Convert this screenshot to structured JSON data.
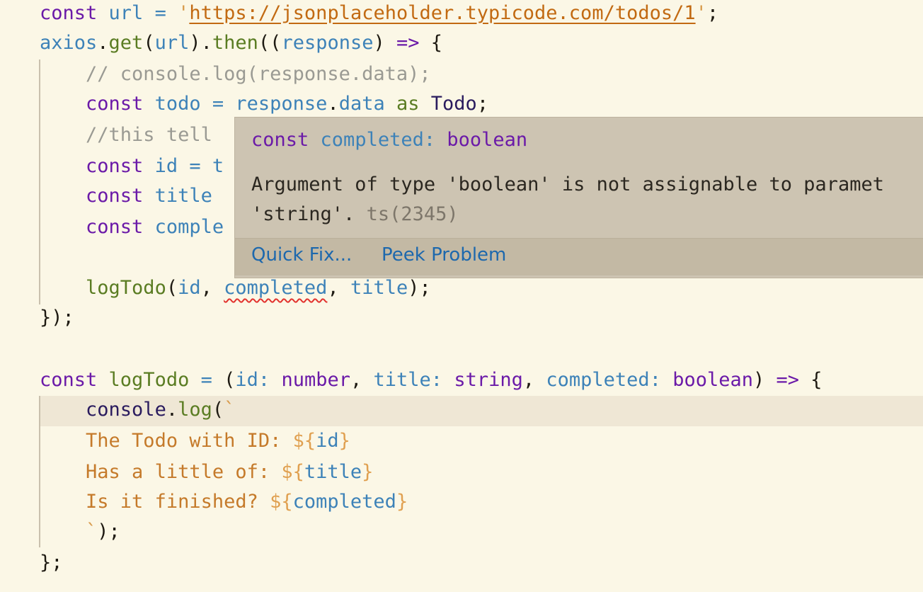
{
  "editor": {
    "lines": {
      "l1": {
        "kw": "const",
        "name": "url",
        "eq": " = ",
        "q1": "'",
        "url": "https://jsonplaceholder.typicode.com/todos/1",
        "q2": "'",
        "end": ";"
      },
      "l2": {
        "obj": "axios",
        "dot1": ".",
        "fn1": "get",
        "p1": "(",
        "arg": "url",
        "p2": ").",
        "fn2": "then",
        "p3": "((",
        "param": "response",
        "p4": ") ",
        "arrow": "=>",
        "brace": " {"
      },
      "l3": {
        "comment": "// console.log(response.data);"
      },
      "l4": {
        "kw": "const",
        "name": "todo",
        "eq": " = ",
        "obj": "response",
        "dot": ".",
        "prop": "data",
        "as": "as",
        "type": "Todo",
        "end": ";"
      },
      "l5": {
        "comment": "//this tell"
      },
      "l6": {
        "kw": "const",
        "name": "id",
        "rest": " = t"
      },
      "l7": {
        "kw": "const",
        "name": "title"
      },
      "l8": {
        "kw": "const",
        "name": "comple"
      },
      "l10": {
        "fn": "logTodo",
        "p1": "(",
        "a1": "id",
        "c1": ", ",
        "a2": "completed",
        "c2": ", ",
        "a3": "title",
        "end": ");"
      },
      "l11": {
        "text": "});"
      },
      "l13": {
        "kw": "const",
        "fn": "logTodo",
        "eq": " = ",
        "p1": "(",
        "n1": "id",
        "col1": ":",
        "t1": "number",
        "c1": ", ",
        "n2": "title",
        "col2": ":",
        "t2": "string",
        "c2": ", ",
        "n3": "completed",
        "col3": ":",
        "t3": "boolean",
        "p2": ") ",
        "arrow": "=>",
        "brace": " {"
      },
      "l14": {
        "obj": "console",
        "dot": ".",
        "fn": "log",
        "p": "(",
        "tick": "`"
      },
      "l15": {
        "text": "The Todo with ID: ",
        "open": "${",
        "var": "id",
        "close": "}"
      },
      "l16": {
        "text": "Has a little of: ",
        "open": "${",
        "var": "title",
        "close": "}"
      },
      "l17": {
        "text": "Is it finished? ",
        "open": "${",
        "var": "completed",
        "close": "}"
      },
      "l18": {
        "tick": "`",
        "end": ");"
      },
      "l19": {
        "text": "};"
      }
    }
  },
  "hover": {
    "sig_kw": "const",
    "sig_name": "completed:",
    "sig_type": "boolean",
    "message_line1": "Argument of type 'boolean' is not assignable to paramet",
    "message_line2": "'string'.",
    "error_code": "ts(2345)",
    "actions": {
      "quick_fix": "Quick Fix...",
      "peek_problem": "Peek Problem"
    }
  },
  "colors": {
    "background": "#fbf7e6",
    "keyword": "#6b1aa8",
    "variable": "#3d82b8",
    "function": "#5a7c22",
    "string": "#c26a12",
    "comment": "#9a9a93",
    "error_squiggle": "#e2322e",
    "hover_background": "#cdc4b2",
    "link": "#1d68ad"
  }
}
